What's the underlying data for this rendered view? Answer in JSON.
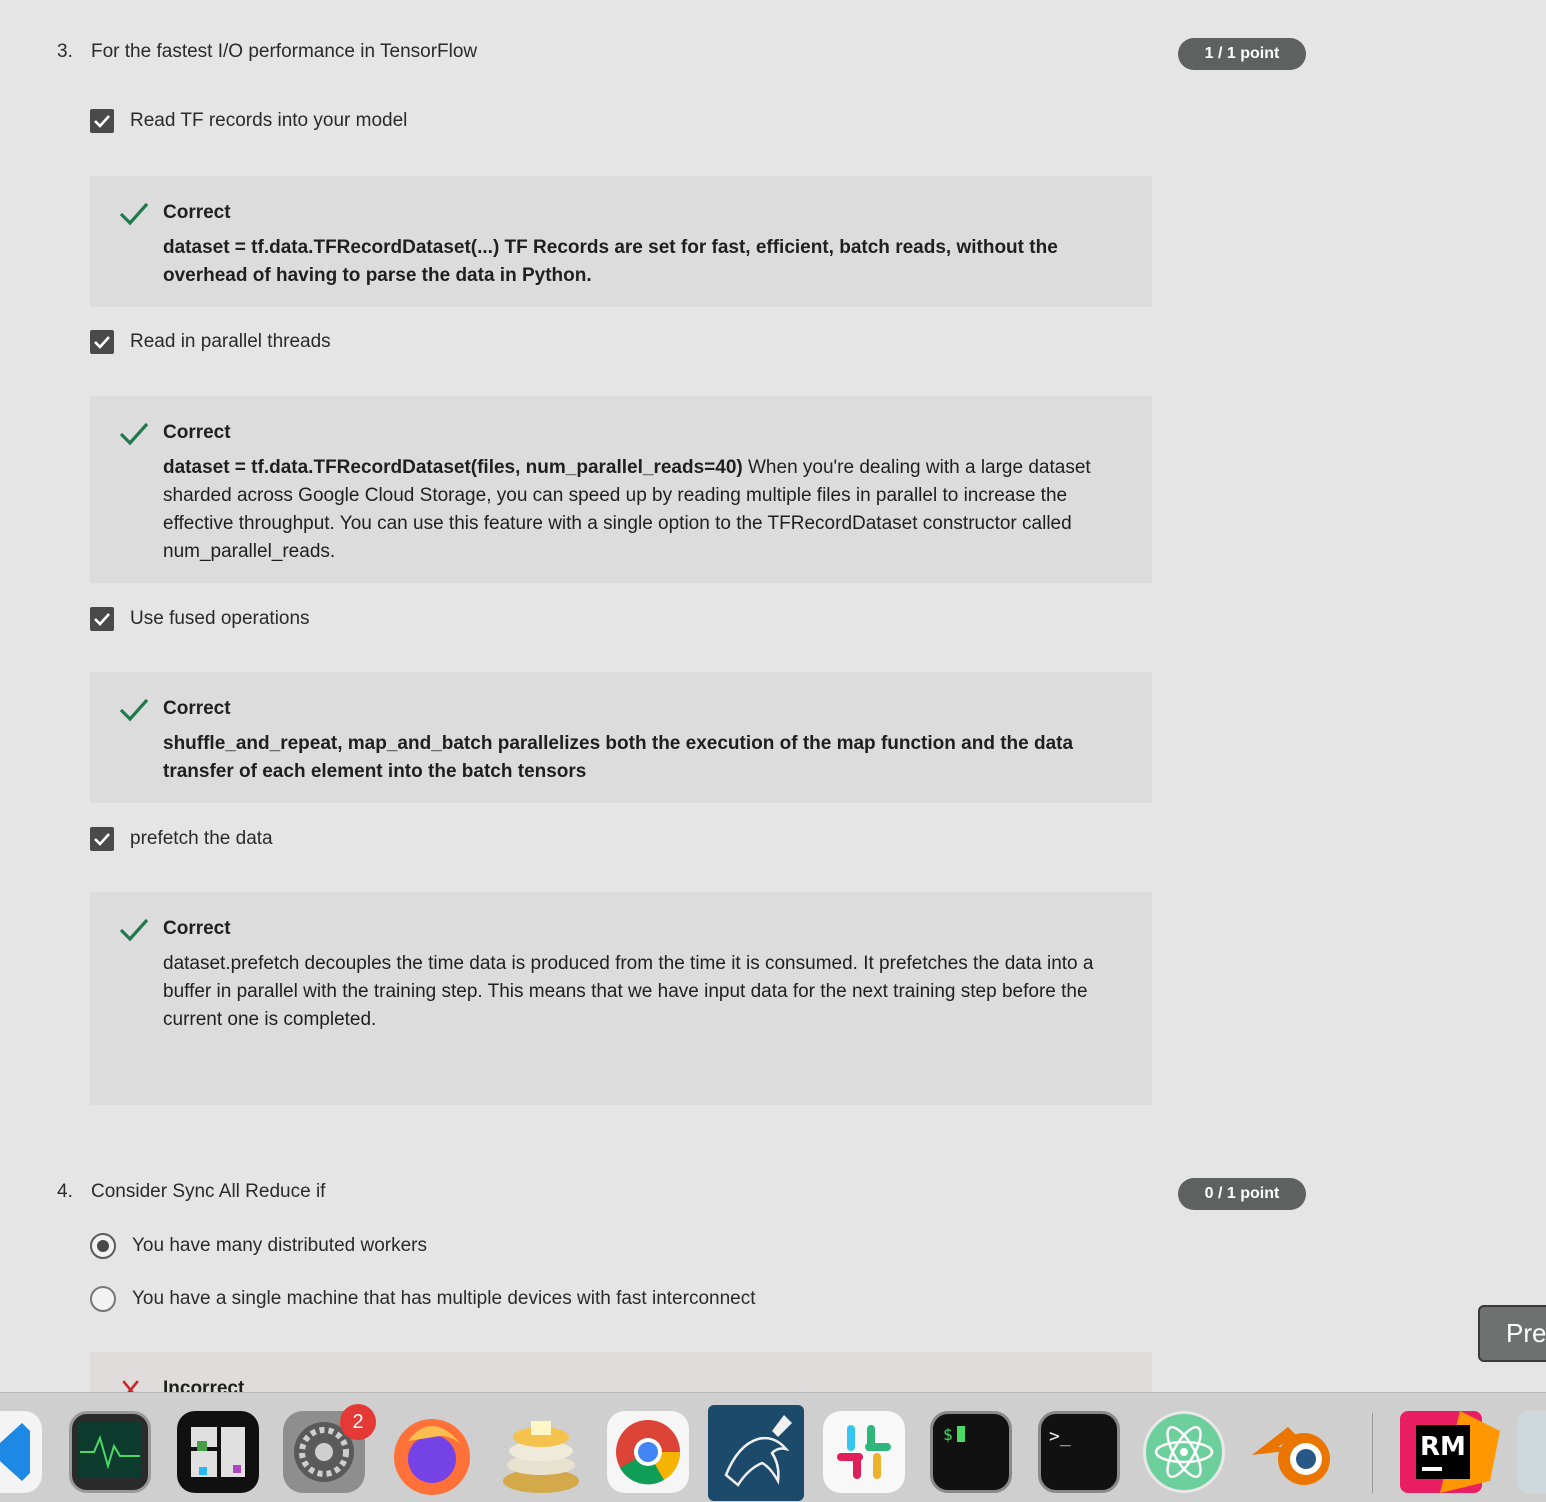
{
  "questions": [
    {
      "number": "3.",
      "text": "For the fastest I/O performance in TensorFlow",
      "points": "1 / 1 point",
      "options": [
        {
          "label": "Read TF records into your model",
          "checked": true,
          "feedback": {
            "status": "Correct",
            "bold": "dataset = tf.data.TFRecordDataset(...) TF Records are set for fast, efficient, batch reads, without the overhead of having to parse the data in Python.",
            "rest": ""
          }
        },
        {
          "label": "Read in parallel threads",
          "checked": true,
          "feedback": {
            "status": "Correct",
            "bold": "dataset = tf.data.TFRecordDataset(files, num_parallel_reads=40)",
            "rest": " When you're dealing with a large dataset sharded across Google Cloud Storage, you can speed up by reading multiple files in parallel to increase the effective throughput. You can use this feature with a single option to the TFRecordDataset constructor called num_parallel_reads."
          }
        },
        {
          "label": "Use fused operations",
          "checked": true,
          "feedback": {
            "status": "Correct",
            "bold": "shuffle_and_repeat, map_and_batch parallelizes both the execution of the map function and the data transfer of each element into the batch tensors",
            "rest": ""
          }
        },
        {
          "label": "prefetch the data",
          "checked": true,
          "feedback": {
            "status": "Correct",
            "bold": "",
            "rest": "dataset.prefetch  decouples the time data is produced from the time it is consumed. It prefetches the data into a buffer in parallel with the training step. This means that we have input data for the next training step before the current one is completed."
          }
        }
      ]
    },
    {
      "number": "4.",
      "text": "Consider Sync All Reduce if",
      "points": "0 / 1 point",
      "options": [
        {
          "label": "You have many distributed workers",
          "selected": true
        },
        {
          "label": "You have a single machine that has multiple devices with fast interconnect",
          "selected": false
        }
      ],
      "feedback": {
        "status": "Incorrect"
      }
    }
  ],
  "floating_button": {
    "label": "Pre"
  },
  "dock": {
    "apps": [
      "vscode",
      "activity-monitor",
      "mosaic",
      "system-preferences",
      "firefox",
      "sequel-pro",
      "chrome",
      "mysql-workbench",
      "slack",
      "iterm",
      "terminal",
      "atom",
      "blender",
      "rubymine",
      "preview"
    ],
    "system_preferences_badge": "2"
  },
  "colors": {
    "correct": "#1e7a4a",
    "incorrect": "#c62828",
    "badge": "#5f6060"
  }
}
